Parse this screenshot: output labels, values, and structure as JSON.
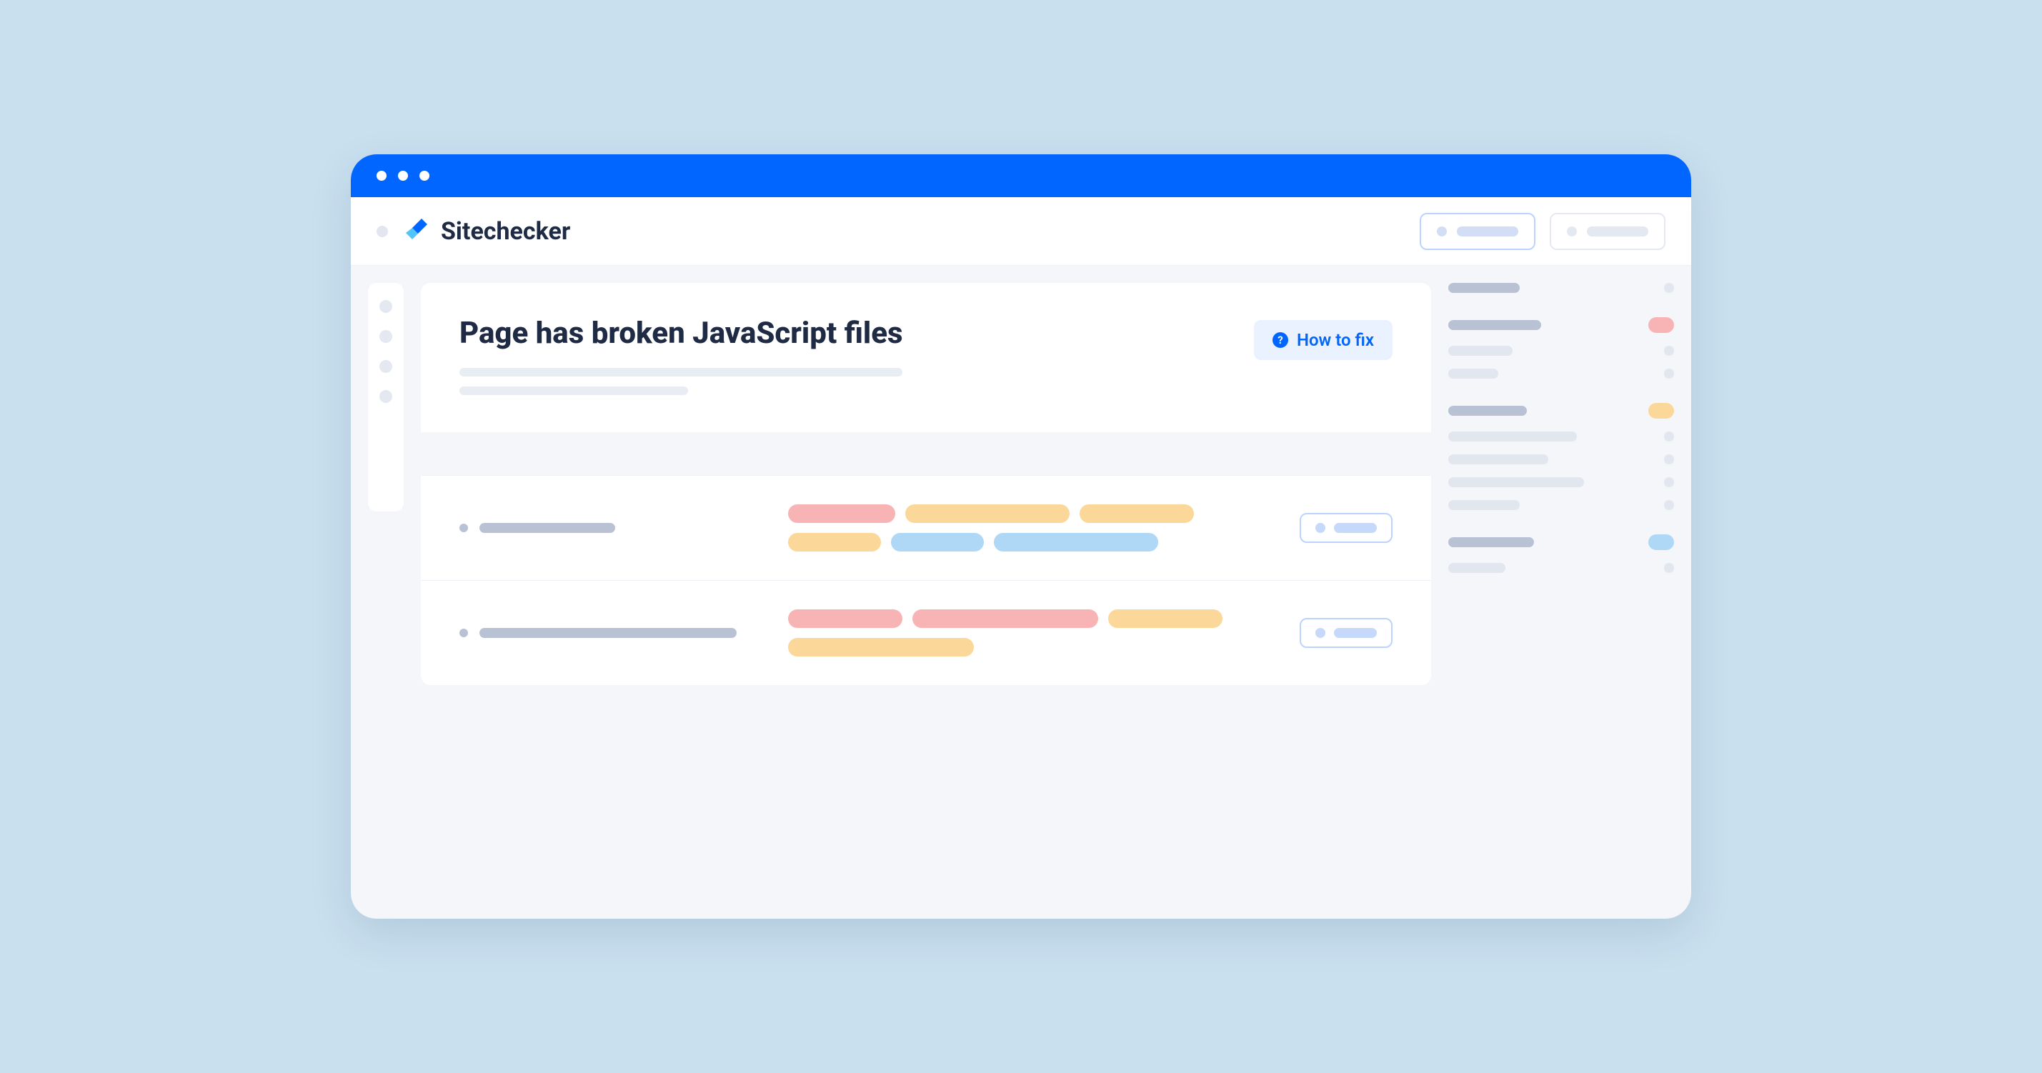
{
  "brand": "Sitechecker",
  "card": {
    "title": "Page has broken JavaScript files",
    "howto_label": "How to fix"
  },
  "colors": {
    "accent": "#0066ff",
    "red": "#f8b4b4",
    "orange": "#fbd89a",
    "blue": "#aed8f5"
  }
}
